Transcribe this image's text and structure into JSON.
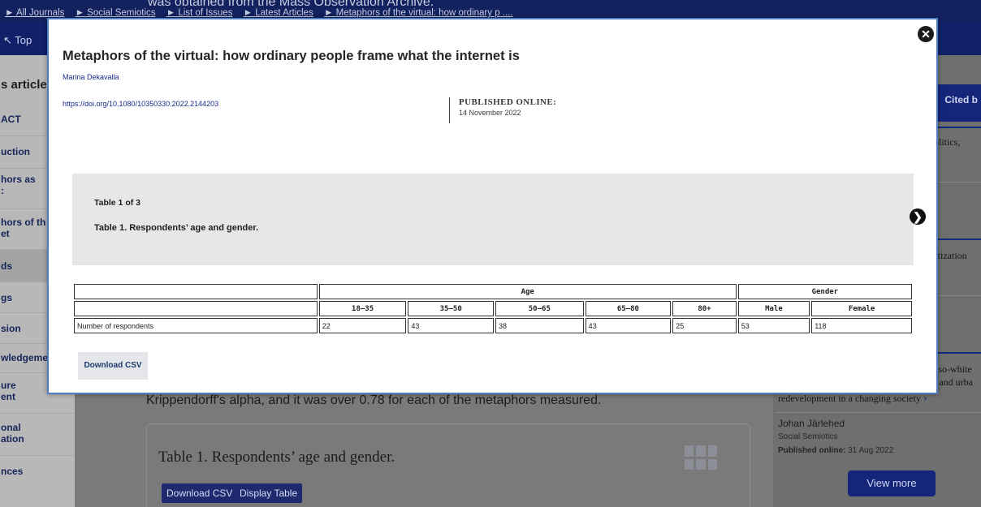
{
  "background": {
    "breadcrumb": [
      "► All Journals",
      "► Social Semiotics",
      "► List of Issues",
      "► Latest Articles",
      "► Metaphors of the virtual: how ordinary p ...."
    ],
    "obscured_text": "was obtained from the Mass Observation Archive.",
    "top_link": "↖ Top",
    "left_nav": {
      "heading": "s article",
      "items": [
        "ACT",
        "uction",
        "hors as\n:",
        "hors of th\net",
        "ds",
        "gs",
        "sion",
        "wledgeme",
        "ure\nent",
        "onal\nation",
        "nces"
      ]
    },
    "content": {
      "paragraph": "Krippendorff's alpha, and it was over 0.78 for each of the metaphors measured.",
      "table_title": "Table 1. Respondents’ age and gender.",
      "download_csv": "Download CSV",
      "display_table": "Display Table"
    },
    "sidebar": {
      "cited_by": "Cited b",
      "snippet_1": ", politics,",
      "snippet_2": "diatization",
      "snippet_3": "t-so-white",
      "snippet_4": "; and urba",
      "snippet_5": "redevelopment in a changing society",
      "author": "Johan Järlehed",
      "journal": "Social Semiotics",
      "published_label": "Published online:",
      "published_date": "31 Aug 2022",
      "view_more": "View more"
    }
  },
  "modal": {
    "close_icon": "✕",
    "title": "Metaphors of the virtual: how ordinary people frame what the internet is",
    "author": "Marina Dekavalla",
    "doi": "https://doi.org/10.1080/10350330.2022.2144203",
    "published_label": "PUBLISHED ONLINE:",
    "published_date": "14 November 2022",
    "table_counter": "Table 1 of 3",
    "table_caption": "Table 1. Respondents’ age and gender.",
    "next_icon": "❯",
    "table": {
      "group_headers": {
        "age": "Age",
        "gender": "Gender"
      },
      "columns": [
        "18–35",
        "35–50",
        "50–65",
        "65–80",
        "80+",
        "Male",
        "Female"
      ],
      "row_label": "Number of respondents",
      "values": [
        "22",
        "43",
        "38",
        "43",
        "25",
        "53",
        "118"
      ]
    },
    "download_csv": "Download CSV"
  }
}
